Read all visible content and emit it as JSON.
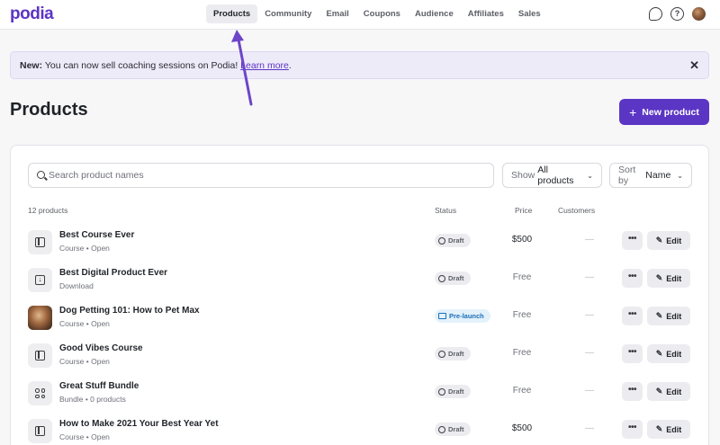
{
  "app": {
    "logo": "podia"
  },
  "nav": [
    {
      "label": "Products",
      "active": true
    },
    {
      "label": "Community"
    },
    {
      "label": "Email"
    },
    {
      "label": "Coupons"
    },
    {
      "label": "Audience"
    },
    {
      "label": "Affiliates"
    },
    {
      "label": "Sales"
    }
  ],
  "top_icons": {
    "chat": "chat-bubble-icon",
    "help": "question-circle-icon",
    "help_glyph": "?"
  },
  "banner": {
    "prefix": "New:",
    "text": "You can now sell coaching sessions on Podia!",
    "link": "Learn more",
    "suffix": ".",
    "close": "✕"
  },
  "page": {
    "title": "Products",
    "new_button": "New product",
    "plus": "+"
  },
  "filters": {
    "search_placeholder": "Search product names",
    "show_prefix": "Show",
    "show_value": "All products",
    "sort_prefix": "Sort by",
    "sort_value": "Name",
    "chevron": "⌄"
  },
  "table": {
    "count": "12 products",
    "col_status": "Status",
    "col_price": "Price",
    "col_customers": "Customers",
    "more": "•••",
    "edit": "Edit",
    "pencil": "✎",
    "rows": [
      {
        "name": "Best Course Ever",
        "sub": "Course • Open",
        "icon": "course",
        "status": "Draft",
        "price": "$500",
        "customers": "—"
      },
      {
        "name": "Best Digital Product Ever",
        "sub": "Download",
        "icon": "download",
        "status": "Draft",
        "price": "Free",
        "customers": "—"
      },
      {
        "name": "Dog Petting 101: How to Pet Max",
        "sub": "Course • Open",
        "icon": "photo",
        "status": "Pre-launch",
        "price": "Free",
        "customers": "—"
      },
      {
        "name": "Good Vibes Course",
        "sub": "Course • Open",
        "icon": "course",
        "status": "Draft",
        "price": "Free",
        "customers": "—"
      },
      {
        "name": "Great Stuff Bundle",
        "sub": "Bundle • 0 products",
        "icon": "bundle",
        "status": "Draft",
        "price": "Free",
        "customers": "—"
      },
      {
        "name": "How to Make 2021 Your Best Year Yet",
        "sub": "Course • Open",
        "icon": "course",
        "status": "Draft",
        "price": "$500",
        "customers": "—"
      }
    ]
  },
  "colors": {
    "brand": "#5b35c4",
    "annotation_arrow": "#6d45c9"
  }
}
